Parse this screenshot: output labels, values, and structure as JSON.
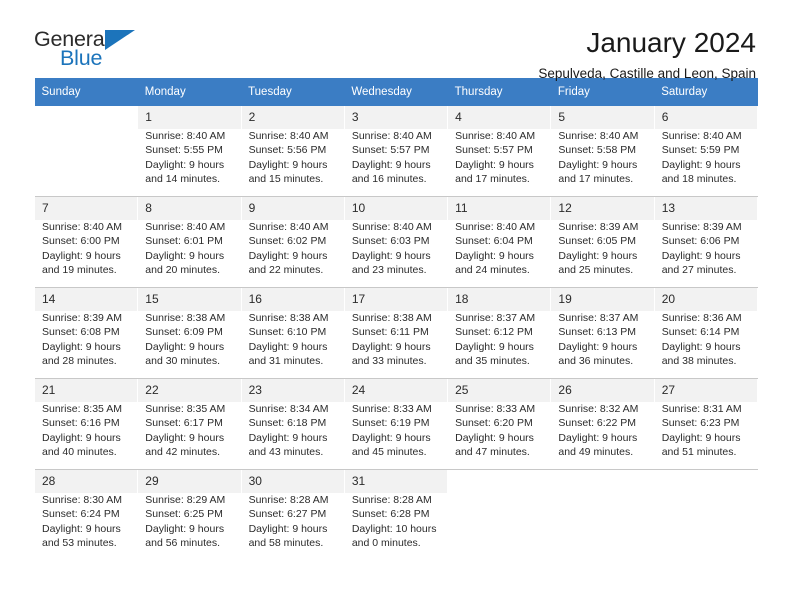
{
  "logo": {
    "word_top": "General",
    "word_bottom": "Blue",
    "flag_icon": "blue-flag-triangle-icon",
    "brand_color": "#1c74bb"
  },
  "header": {
    "title": "January 2024",
    "location": "Sepulveda, Castille and Leon, Spain"
  },
  "calendar": {
    "header_bg": "#3b7dc4",
    "weekdays": [
      "Sunday",
      "Monday",
      "Tuesday",
      "Wednesday",
      "Thursday",
      "Friday",
      "Saturday"
    ],
    "weeks": [
      [
        {
          "day": "",
          "sunrise": "",
          "sunset": "",
          "daylight_line1": "",
          "daylight_line2": ""
        },
        {
          "day": "1",
          "sunrise": "Sunrise: 8:40 AM",
          "sunset": "Sunset: 5:55 PM",
          "daylight_line1": "Daylight: 9 hours",
          "daylight_line2": "and 14 minutes."
        },
        {
          "day": "2",
          "sunrise": "Sunrise: 8:40 AM",
          "sunset": "Sunset: 5:56 PM",
          "daylight_line1": "Daylight: 9 hours",
          "daylight_line2": "and 15 minutes."
        },
        {
          "day": "3",
          "sunrise": "Sunrise: 8:40 AM",
          "sunset": "Sunset: 5:57 PM",
          "daylight_line1": "Daylight: 9 hours",
          "daylight_line2": "and 16 minutes."
        },
        {
          "day": "4",
          "sunrise": "Sunrise: 8:40 AM",
          "sunset": "Sunset: 5:57 PM",
          "daylight_line1": "Daylight: 9 hours",
          "daylight_line2": "and 17 minutes."
        },
        {
          "day": "5",
          "sunrise": "Sunrise: 8:40 AM",
          "sunset": "Sunset: 5:58 PM",
          "daylight_line1": "Daylight: 9 hours",
          "daylight_line2": "and 17 minutes."
        },
        {
          "day": "6",
          "sunrise": "Sunrise: 8:40 AM",
          "sunset": "Sunset: 5:59 PM",
          "daylight_line1": "Daylight: 9 hours",
          "daylight_line2": "and 18 minutes."
        }
      ],
      [
        {
          "day": "7",
          "sunrise": "Sunrise: 8:40 AM",
          "sunset": "Sunset: 6:00 PM",
          "daylight_line1": "Daylight: 9 hours",
          "daylight_line2": "and 19 minutes."
        },
        {
          "day": "8",
          "sunrise": "Sunrise: 8:40 AM",
          "sunset": "Sunset: 6:01 PM",
          "daylight_line1": "Daylight: 9 hours",
          "daylight_line2": "and 20 minutes."
        },
        {
          "day": "9",
          "sunrise": "Sunrise: 8:40 AM",
          "sunset": "Sunset: 6:02 PM",
          "daylight_line1": "Daylight: 9 hours",
          "daylight_line2": "and 22 minutes."
        },
        {
          "day": "10",
          "sunrise": "Sunrise: 8:40 AM",
          "sunset": "Sunset: 6:03 PM",
          "daylight_line1": "Daylight: 9 hours",
          "daylight_line2": "and 23 minutes."
        },
        {
          "day": "11",
          "sunrise": "Sunrise: 8:40 AM",
          "sunset": "Sunset: 6:04 PM",
          "daylight_line1": "Daylight: 9 hours",
          "daylight_line2": "and 24 minutes."
        },
        {
          "day": "12",
          "sunrise": "Sunrise: 8:39 AM",
          "sunset": "Sunset: 6:05 PM",
          "daylight_line1": "Daylight: 9 hours",
          "daylight_line2": "and 25 minutes."
        },
        {
          "day": "13",
          "sunrise": "Sunrise: 8:39 AM",
          "sunset": "Sunset: 6:06 PM",
          "daylight_line1": "Daylight: 9 hours",
          "daylight_line2": "and 27 minutes."
        }
      ],
      [
        {
          "day": "14",
          "sunrise": "Sunrise: 8:39 AM",
          "sunset": "Sunset: 6:08 PM",
          "daylight_line1": "Daylight: 9 hours",
          "daylight_line2": "and 28 minutes."
        },
        {
          "day": "15",
          "sunrise": "Sunrise: 8:38 AM",
          "sunset": "Sunset: 6:09 PM",
          "daylight_line1": "Daylight: 9 hours",
          "daylight_line2": "and 30 minutes."
        },
        {
          "day": "16",
          "sunrise": "Sunrise: 8:38 AM",
          "sunset": "Sunset: 6:10 PM",
          "daylight_line1": "Daylight: 9 hours",
          "daylight_line2": "and 31 minutes."
        },
        {
          "day": "17",
          "sunrise": "Sunrise: 8:38 AM",
          "sunset": "Sunset: 6:11 PM",
          "daylight_line1": "Daylight: 9 hours",
          "daylight_line2": "and 33 minutes."
        },
        {
          "day": "18",
          "sunrise": "Sunrise: 8:37 AM",
          "sunset": "Sunset: 6:12 PM",
          "daylight_line1": "Daylight: 9 hours",
          "daylight_line2": "and 35 minutes."
        },
        {
          "day": "19",
          "sunrise": "Sunrise: 8:37 AM",
          "sunset": "Sunset: 6:13 PM",
          "daylight_line1": "Daylight: 9 hours",
          "daylight_line2": "and 36 minutes."
        },
        {
          "day": "20",
          "sunrise": "Sunrise: 8:36 AM",
          "sunset": "Sunset: 6:14 PM",
          "daylight_line1": "Daylight: 9 hours",
          "daylight_line2": "and 38 minutes."
        }
      ],
      [
        {
          "day": "21",
          "sunrise": "Sunrise: 8:35 AM",
          "sunset": "Sunset: 6:16 PM",
          "daylight_line1": "Daylight: 9 hours",
          "daylight_line2": "and 40 minutes."
        },
        {
          "day": "22",
          "sunrise": "Sunrise: 8:35 AM",
          "sunset": "Sunset: 6:17 PM",
          "daylight_line1": "Daylight: 9 hours",
          "daylight_line2": "and 42 minutes."
        },
        {
          "day": "23",
          "sunrise": "Sunrise: 8:34 AM",
          "sunset": "Sunset: 6:18 PM",
          "daylight_line1": "Daylight: 9 hours",
          "daylight_line2": "and 43 minutes."
        },
        {
          "day": "24",
          "sunrise": "Sunrise: 8:33 AM",
          "sunset": "Sunset: 6:19 PM",
          "daylight_line1": "Daylight: 9 hours",
          "daylight_line2": "and 45 minutes."
        },
        {
          "day": "25",
          "sunrise": "Sunrise: 8:33 AM",
          "sunset": "Sunset: 6:20 PM",
          "daylight_line1": "Daylight: 9 hours",
          "daylight_line2": "and 47 minutes."
        },
        {
          "day": "26",
          "sunrise": "Sunrise: 8:32 AM",
          "sunset": "Sunset: 6:22 PM",
          "daylight_line1": "Daylight: 9 hours",
          "daylight_line2": "and 49 minutes."
        },
        {
          "day": "27",
          "sunrise": "Sunrise: 8:31 AM",
          "sunset": "Sunset: 6:23 PM",
          "daylight_line1": "Daylight: 9 hours",
          "daylight_line2": "and 51 minutes."
        }
      ],
      [
        {
          "day": "28",
          "sunrise": "Sunrise: 8:30 AM",
          "sunset": "Sunset: 6:24 PM",
          "daylight_line1": "Daylight: 9 hours",
          "daylight_line2": "and 53 minutes."
        },
        {
          "day": "29",
          "sunrise": "Sunrise: 8:29 AM",
          "sunset": "Sunset: 6:25 PM",
          "daylight_line1": "Daylight: 9 hours",
          "daylight_line2": "and 56 minutes."
        },
        {
          "day": "30",
          "sunrise": "Sunrise: 8:28 AM",
          "sunset": "Sunset: 6:27 PM",
          "daylight_line1": "Daylight: 9 hours",
          "daylight_line2": "and 58 minutes."
        },
        {
          "day": "31",
          "sunrise": "Sunrise: 8:28 AM",
          "sunset": "Sunset: 6:28 PM",
          "daylight_line1": "Daylight: 10 hours",
          "daylight_line2": "and 0 minutes."
        },
        {
          "day": "",
          "sunrise": "",
          "sunset": "",
          "daylight_line1": "",
          "daylight_line2": ""
        },
        {
          "day": "",
          "sunrise": "",
          "sunset": "",
          "daylight_line1": "",
          "daylight_line2": ""
        },
        {
          "day": "",
          "sunrise": "",
          "sunset": "",
          "daylight_line1": "",
          "daylight_line2": ""
        }
      ]
    ]
  }
}
